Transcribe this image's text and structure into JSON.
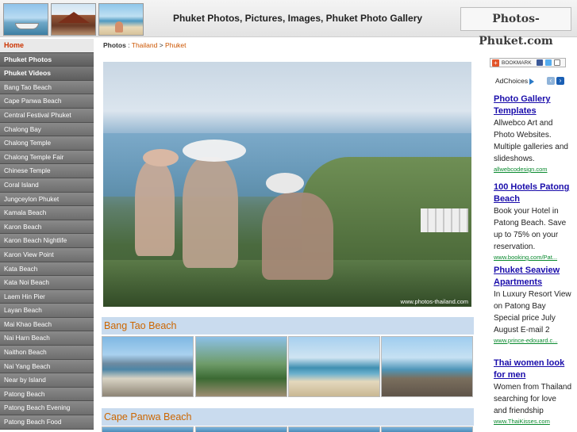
{
  "header": {
    "title": "Phuket Photos, Pictures, Images, Phuket Photo Gallery",
    "logo_text": "Photos-Phuket.com"
  },
  "sidebar": {
    "items": [
      {
        "label": "Home",
        "style": "home"
      },
      {
        "label": "Phuket Photos",
        "style": "bold"
      },
      {
        "label": "Phuket Videos",
        "style": "bold"
      },
      {
        "label": "Bang Tao Beach"
      },
      {
        "label": "Cape Panwa Beach"
      },
      {
        "label": "Central Festival Phuket"
      },
      {
        "label": "Chalong Bay"
      },
      {
        "label": "Chalong Temple"
      },
      {
        "label": "Chalong Temple Fair"
      },
      {
        "label": "Chinese Temple"
      },
      {
        "label": "Coral Island"
      },
      {
        "label": "Jungceylon Phuket"
      },
      {
        "label": "Kamala Beach"
      },
      {
        "label": "Karon Beach"
      },
      {
        "label": "Karon Beach Nightlife"
      },
      {
        "label": "Karon View Point"
      },
      {
        "label": "Kata Beach"
      },
      {
        "label": "Kata Noi Beach"
      },
      {
        "label": "Laem Hin Pier"
      },
      {
        "label": "Layan Beach"
      },
      {
        "label": "Mai Khao Beach"
      },
      {
        "label": "Nai Harn Beach"
      },
      {
        "label": "Naithon Beach"
      },
      {
        "label": "Nai Yang Beach"
      },
      {
        "label": "Near by Island"
      },
      {
        "label": "Patong Beach"
      },
      {
        "label": "Patong Beach Evening"
      },
      {
        "label": "Patong Beach Food"
      }
    ]
  },
  "breadcrumb": {
    "root": "Photos",
    "sep1": " : ",
    "level1": "Thailand",
    "sep2": " > ",
    "level2": "Phuket"
  },
  "hero": {
    "watermark": "www.photos-thailand.com"
  },
  "sections": [
    {
      "title": "Bang Tao Beach"
    },
    {
      "title": "Cape Panwa Beach"
    }
  ],
  "right": {
    "bookmark_label": "BOOKMARK",
    "ad_choices_label": "AdChoices",
    "ads": [
      {
        "title": "Photo Gallery Templates",
        "text": "Allwebco Art and Photo Websites. Multiple galleries and slideshows.",
        "url": "allwebcodesign.com"
      },
      {
        "title": "100 Hotels Patong Beach",
        "text": "Book your Hotel in Patong Beach. Save up to 75% on your reservation.",
        "url": "www.booking.com/Pat..."
      },
      {
        "title": "Phuket Seaview Apartments",
        "text": "In Luxury Resort View on Patong Bay Special price July August E-mail 2",
        "url": "www.prince-edouard.c..."
      },
      {
        "title": "Thai women look for men",
        "text": "Women from Thailand searching for love and friendship",
        "url": "www.ThaiKisses.com"
      }
    ]
  },
  "colors": {
    "accent_orange": "#cc6600",
    "section_bg": "#c9dbee",
    "ad_link": "#1a0dab",
    "ad_url": "#0a8a2f",
    "sidebar_bg": "#7d7d7d"
  }
}
